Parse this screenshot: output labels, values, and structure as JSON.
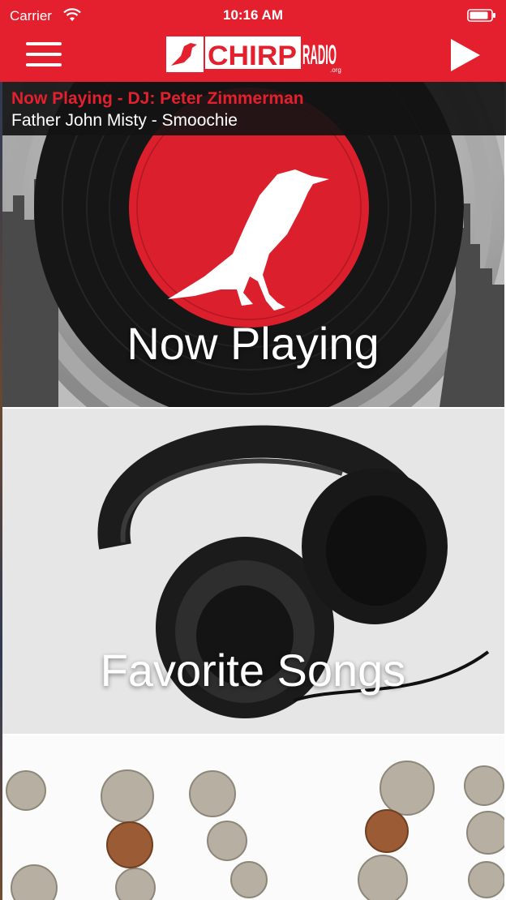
{
  "status_bar": {
    "carrier": "Carrier",
    "time": "10:16 AM"
  },
  "header": {
    "menu_icon": "hamburger-icon",
    "logo_text_left": "CHIRP",
    "logo_text_right": "RADIO",
    "logo_suffix": ".org",
    "play_icon": "play-icon",
    "color": "#e4202e"
  },
  "now_playing_strip": {
    "dj_line": "Now Playing - DJ: Peter Zimmerman",
    "track_line": "Father John Misty - Smoochie"
  },
  "panels": [
    {
      "label": "Now Playing"
    },
    {
      "label": "Favorite Songs"
    },
    {
      "label": ""
    }
  ]
}
